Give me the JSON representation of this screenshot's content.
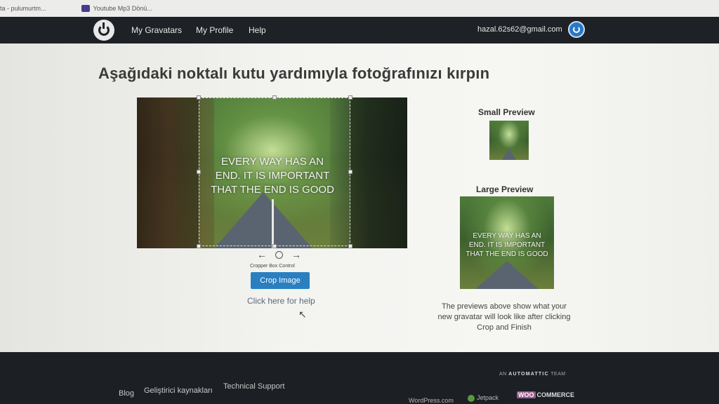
{
  "bookmarks": [
    {
      "label": "ta - pulumurtm..."
    },
    {
      "label": "Youtube Mp3 Dönü..."
    }
  ],
  "nav": {
    "links": [
      "My Gravatars",
      "My Profile",
      "Help"
    ],
    "email": "hazal.62s62@gmail.com"
  },
  "page": {
    "title": "Aşağıdaki noktalı kutu yardımıyla fotoğrafınızı kırpın"
  },
  "cropper": {
    "image_quote_lines": [
      "EVERY WAY HAS AN",
      "END. IT IS IMPORTANT",
      "THAT THE END IS GOOD"
    ],
    "control_left": "←",
    "control_right": "→",
    "control_label": "Cropper Box Control",
    "crop_button": "Crop Image",
    "help_link": "Click here for help"
  },
  "preview": {
    "small_title": "Small Preview",
    "large_title": "Large Preview",
    "large_quote_lines": [
      "EVERY WAY HAS AN",
      "END. IT IS IMPORTANT",
      "THAT THE END IS GOOD"
    ],
    "note": "The previews above show what your new gravatar will look like after clicking Crop and Finish"
  },
  "footer": {
    "links": [
      "Blog",
      "Geliştirici kaynakları",
      "Technical Support"
    ],
    "team_prefix": "AN",
    "team_brand": "AUTOMATTIC",
    "team_suffix": "TEAM",
    "wordpress": "WordPress.com",
    "jetpack": "Jetpack",
    "woo_a": "WOO",
    "woo_b": "COMMERCE"
  },
  "colors": {
    "nav_bg": "#1e2227",
    "button_bg": "#2a7fc0",
    "footer_bg": "#1c1f24"
  }
}
